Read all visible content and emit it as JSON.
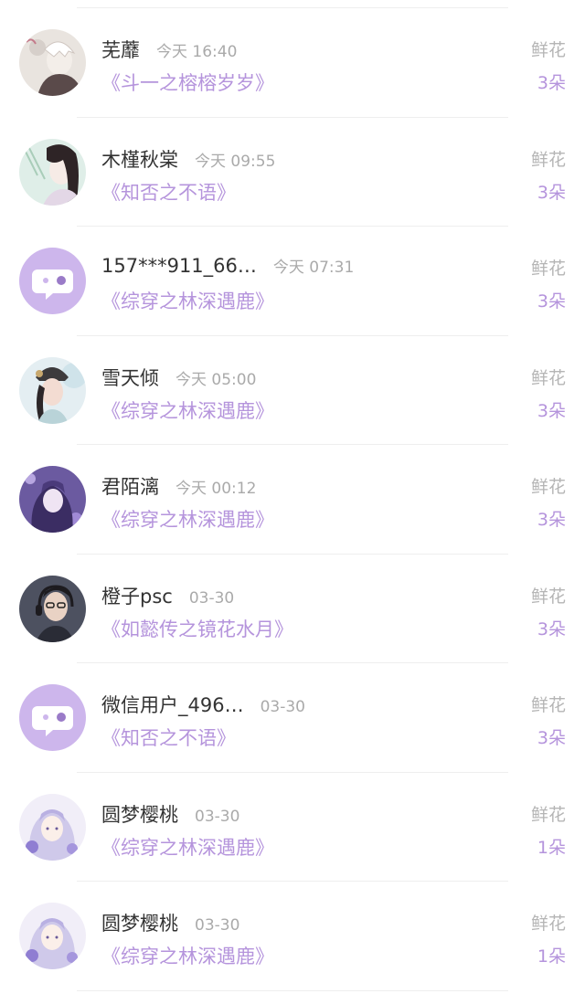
{
  "rows": [
    {
      "name": "芜蘼",
      "time": "今天 16:40",
      "book": "《斗一之榕榕岁岁》",
      "gift": "鲜花",
      "count": "3朵",
      "avatar": "photo-white-hair-boy"
    },
    {
      "name": "木槿秋棠",
      "time": "今天 09:55",
      "book": "《知否之不语》",
      "gift": "鲜花",
      "count": "3朵",
      "avatar": "photo-ancient-lady-bamboo"
    },
    {
      "name": "157***911_66…",
      "time": "今天 07:31",
      "book": "《综穿之林深遇鹿》",
      "gift": "鲜花",
      "count": "3朵",
      "avatar": "default-chat-bubble"
    },
    {
      "name": "雪天倾",
      "time": "今天 05:00",
      "book": "《综穿之林深遇鹿》",
      "gift": "鲜花",
      "count": "3朵",
      "avatar": "photo-lady-headdress"
    },
    {
      "name": "君陌漓",
      "time": "今天 00:12",
      "book": "《综穿之林深遇鹿》",
      "gift": "鲜花",
      "count": "3朵",
      "avatar": "photo-purple-anime-girl"
    },
    {
      "name": "橙子psc",
      "time": "03-30",
      "book": "《如懿传之镜花水月》",
      "gift": "鲜花",
      "count": "3朵",
      "avatar": "photo-boy-headphones"
    },
    {
      "name": "微信用户_496…",
      "time": "03-30",
      "book": "《知否之不语》",
      "gift": "鲜花",
      "count": "3朵",
      "avatar": "default-chat-bubble"
    },
    {
      "name": "圆梦樱桃",
      "time": "03-30",
      "book": "《综穿之林深遇鹿》",
      "gift": "鲜花",
      "count": "1朵",
      "avatar": "photo-anime-girl-flowers"
    },
    {
      "name": "圆梦樱桃",
      "time": "03-30",
      "book": "《综穿之林深遇鹿》",
      "gift": "鲜花",
      "count": "1朵",
      "avatar": "photo-anime-girl-flowers"
    }
  ],
  "colors": {
    "accent": "#b594dc",
    "name": "#333333",
    "muted": "#aaaaaa",
    "divider": "#eeeeee",
    "default_avatar_bg": "#cdb6ec"
  }
}
